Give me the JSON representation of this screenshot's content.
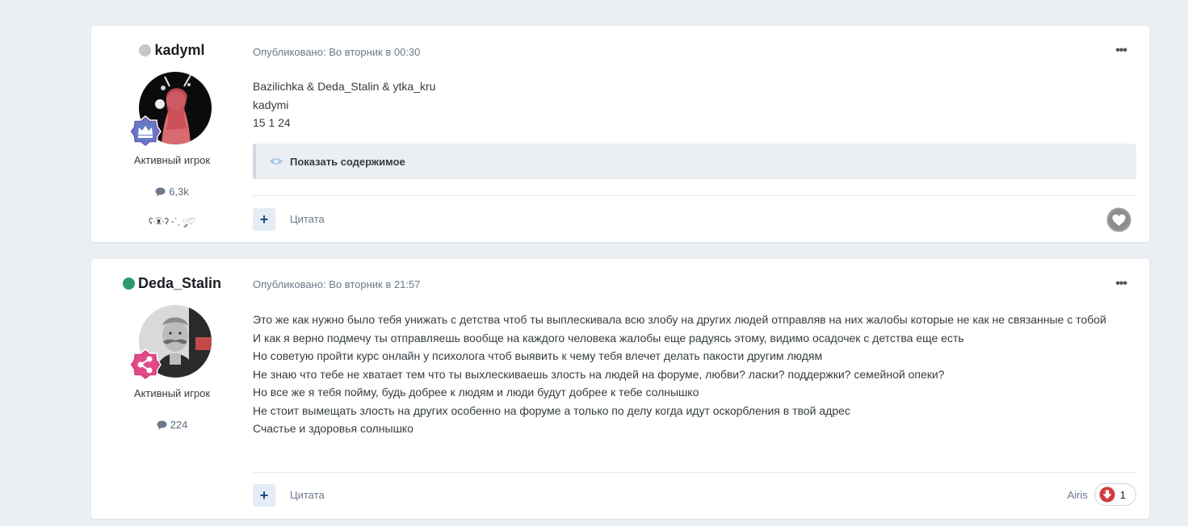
{
  "colors": {
    "offline": "#c7c7c7",
    "online": "#2c9a6c",
    "badge_purple": "#6c55b5",
    "badge_pink": "#d8367b",
    "accent": "#1f4c82",
    "downvote": "#cf3c3c"
  },
  "posts": [
    {
      "author": {
        "name": "kadyml",
        "status": "offline",
        "group": "Активный игрок",
        "posts_count": "6,3k",
        "signature": "ʕ·͡ᴥ·ʔ -ˋˏ ༘♡",
        "badge_icon": "crown-icon"
      },
      "meta": "Опубликовано: Во вторник в 00:30",
      "content": [
        "Bazilichka & Deda_Stalin & ytka_kru",
        "kadymi",
        "15 1 24"
      ],
      "spoiler_label": "Показать содержимое",
      "quote_label": "Цитата",
      "plus_label": "+"
    },
    {
      "author": {
        "name": "Deda_Stalin",
        "status": "online",
        "group": "Активный игрок",
        "posts_count": "224",
        "badge_icon": "share-icon"
      },
      "meta": "Опубликовано: Во вторник в 21:57",
      "content": [
        "Это же как нужно было тебя унижать с детства чтоб ты выплескивала всю злобу на других людей отправляв на них жалобы которые не как не связанные с тобой",
        "И как я верно подмечу ты отправляешь вообще на каждого человека жалобы еще радуясь этому, видимо осадочек с детства еще есть",
        "Но советую пройти курс онлайн у психолога чтоб выявить к чему тебя влечет делать пакости другим людям",
        "Не знаю что тебе не хватает тем что ты выхлескиваешь злость на людей на форуме, любви? ласки? поддержки? семейной опеки?",
        "Но все же я тебя пойму, будь добрее к людям и люди будут добрее к тебе солнышко",
        "Не стоит вымещать злость на других особенно на форуме а только по делу когда идут оскорбления в твой адрес",
        "Счастье и здоровья солнышко"
      ],
      "quote_label": "Цитата",
      "plus_label": "+",
      "reaction": {
        "user": "Airis",
        "count": "1",
        "icon": "downvote-icon"
      }
    }
  ]
}
